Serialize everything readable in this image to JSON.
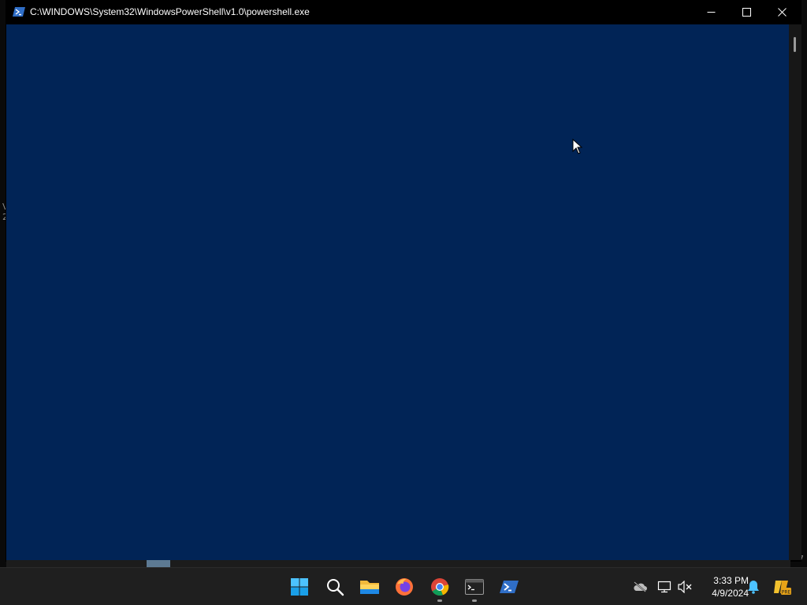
{
  "window": {
    "title": "C:\\WINDOWS\\System32\\WindowsPowerShell\\v1.0\\powershell.exe",
    "console_color": "#012456"
  },
  "titlebar_buttons": [
    "minimize-icon",
    "maximize-icon",
    "close-icon"
  ],
  "taskbar": {
    "apps": [
      "windows-start-icon",
      "search-icon",
      "file-explorer-icon",
      "firefox-icon",
      "chrome-icon",
      "terminal-icon",
      "powershell-icon"
    ],
    "tray": [
      "onedrive-icon",
      "network-icon",
      "volume-muted-icon",
      "notifications-icon",
      "copilot-icon"
    ],
    "clock": {
      "time": "3:33 PM",
      "date": "4/9/2024"
    },
    "copilot_badge": "PRE"
  }
}
